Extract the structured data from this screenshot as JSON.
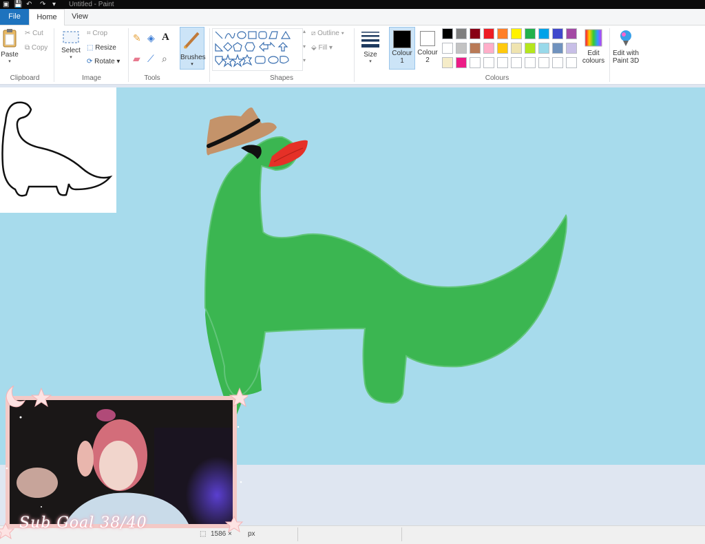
{
  "window": {
    "title": "Untitled - Paint"
  },
  "tabs": {
    "file": "File",
    "home": "Home",
    "view": "View"
  },
  "clipboard": {
    "paste": "Paste",
    "cut": "Cut",
    "copy": "Copy",
    "label": "Clipboard"
  },
  "image": {
    "select": "Select",
    "crop": "Crop",
    "resize": "Resize",
    "rotate": "Rotate",
    "label": "Image"
  },
  "tools": {
    "label": "Tools"
  },
  "brushes": {
    "label": "Brushes"
  },
  "shapes": {
    "outline": "Outline",
    "fill": "Fill",
    "label": "Shapes"
  },
  "size": {
    "label": "Size"
  },
  "colours": {
    "colour1": "Colour",
    "colour1_num": "1",
    "colour2": "Colour",
    "colour2_num": "2",
    "edit_line1": "Edit",
    "edit_line2": "colours",
    "label": "Colours",
    "colour1_value": "#000000",
    "colour2_value": "#ffffff",
    "palette_row1": [
      "#000000",
      "#7f7f7f",
      "#880015",
      "#ed1c24",
      "#ff7f27",
      "#fff200",
      "#22b14c",
      "#00a2e8",
      "#3f48cc",
      "#a349a4"
    ],
    "palette_row2": [
      "#ffffff",
      "#c3c3c3",
      "#b97a57",
      "#ffaec9",
      "#ffc90e",
      "#efe4b0",
      "#b5e61d",
      "#99d9ea",
      "#7092be",
      "#c8bfe7"
    ],
    "palette_row3": [
      "#f5ecc8",
      "#ec1c86",
      "#ffffff",
      "#ffffff",
      "#ffffff",
      "#ffffff",
      "#ffffff",
      "#ffffff",
      "#ffffff",
      "#ffffff"
    ]
  },
  "paint3d": {
    "line1": "Edit with",
    "line2": "Paint 3D"
  },
  "status": {
    "dimensions": "1586 × ",
    "unit": "px"
  },
  "overlay": {
    "sub_goal": "Sub Goal 38/40"
  },
  "canvas": {
    "background": "#a7dbec",
    "dino_color": "#3bb651",
    "hat_color": "#c4936a",
    "lips_color": "#e53027"
  }
}
